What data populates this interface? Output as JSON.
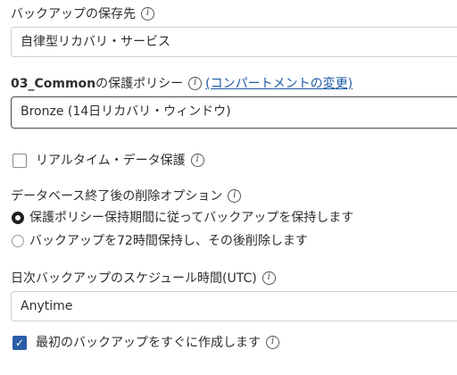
{
  "backup_destination": {
    "label": "バックアップの保存先",
    "value": "自律型リカバリ・サービス"
  },
  "protection_policy": {
    "label_bold": "03_Common",
    "label_rest": "の保護ポリシー",
    "change_link": "(コンパートメントの変更)",
    "value": "Bronze (14日リカバリ・ウィンドウ)"
  },
  "realtime_protection": {
    "label": "リアルタイム・データ保護",
    "checked": false
  },
  "deletion_options": {
    "label": "データベース終了後の削除オプション",
    "options": [
      {
        "label": "保護ポリシー保持期間に従ってバックアップを保持します",
        "selected": true
      },
      {
        "label": "バックアップを72時間保持し、その後削除します",
        "selected": false
      }
    ]
  },
  "daily_schedule": {
    "label": "日次バックアップのスケジュール時間(UTC)",
    "value": "Anytime"
  },
  "create_first_backup": {
    "label": "最初のバックアップをすぐに作成します",
    "checked": true
  },
  "icons": {
    "info": "i",
    "check": "✓"
  }
}
